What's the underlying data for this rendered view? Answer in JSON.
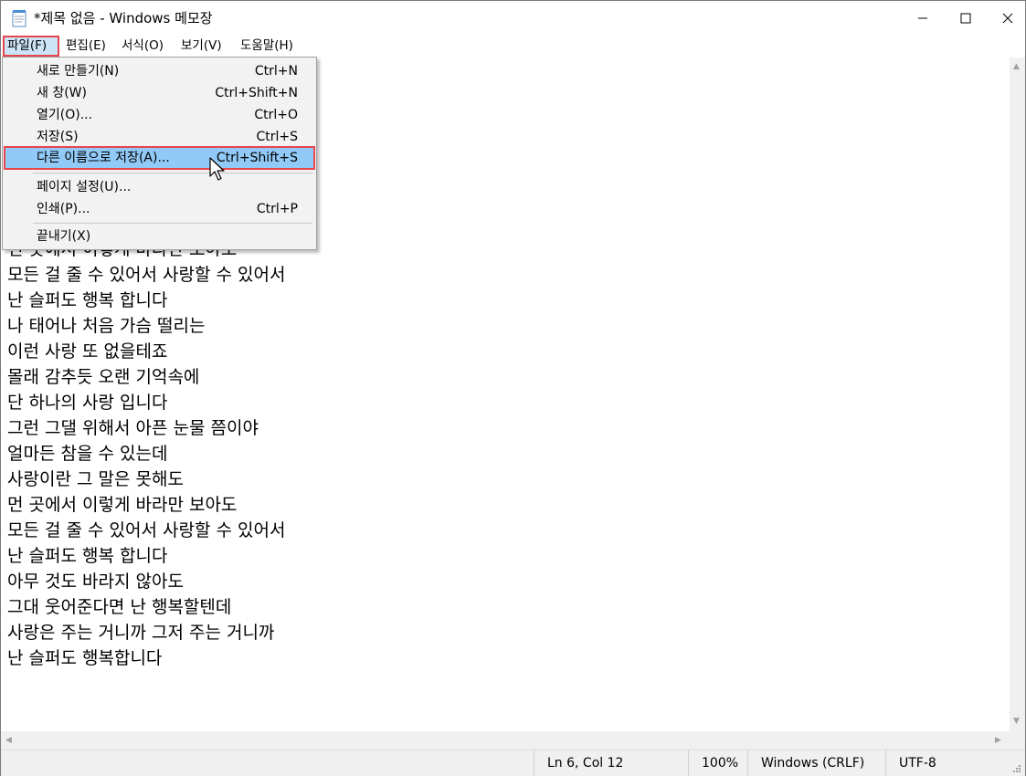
{
  "window": {
    "title": "*제목 없음 - Windows 메모장",
    "app_icon": "notepad-icon",
    "controls": [
      "minimize-icon",
      "maximize-icon",
      "close-icon"
    ]
  },
  "menubar": {
    "items": [
      {
        "label": "파일(F)",
        "active": true
      },
      {
        "label": "편집(E)"
      },
      {
        "label": "서식(O)"
      },
      {
        "label": "보기(V)"
      },
      {
        "label": "도움말(H)"
      }
    ]
  },
  "file_menu": {
    "items": [
      {
        "label": "새로 만들기(N)",
        "shortcut": "Ctrl+N"
      },
      {
        "label": "새 창(W)",
        "shortcut": "Ctrl+Shift+N"
      },
      {
        "label": "열기(O)...",
        "shortcut": "Ctrl+O"
      },
      {
        "label": "저장(S)",
        "shortcut": "Ctrl+S"
      },
      {
        "label": "다른 이름으로 저장(A)...",
        "shortcut": "Ctrl+Shift+S",
        "highlighted": true
      },
      {
        "label": "페이지 설정(U)...",
        "shortcut": ""
      },
      {
        "label": "인쇄(P)...",
        "shortcut": "Ctrl+P"
      },
      {
        "label": "끝내기(X)",
        "shortcut": ""
      }
    ]
  },
  "editor": {
    "lines": [
      "",
      "",
      "",
      "",
      "",
      "",
      "",
      "먼 곳에서 이렇게 바라만 보아도",
      "모든 걸 줄 수 있어서 사랑할 수 있어서",
      "난 슬퍼도 행복 합니다",
      "나 태어나 처음 가슴 떨리는",
      "이런 사랑 또 없을테죠",
      "몰래 감추듯 오랜 기억속에",
      "단 하나의 사랑 입니다",
      "그런 그댈 위해서 아픈 눈물 쯤이야",
      "얼마든 참을 수 있는데",
      "사랑이란 그 말은 못해도",
      "먼 곳에서 이렇게 바라만 보아도",
      "모든 걸 줄 수 있어서 사랑할 수 있어서",
      "난 슬퍼도 행복 합니다",
      "아무 것도 바라지 않아도",
      "그대 웃어준다면 난 행복할텐데",
      "사랑은 주는 거니까 그저 주는 거니까",
      "난 슬퍼도 행복합니다"
    ]
  },
  "statusbar": {
    "position": "Ln 6, Col 12",
    "zoom": "100%",
    "line_ending": "Windows (CRLF)",
    "encoding": "UTF-8"
  },
  "colors": {
    "highlight": "#91c9f7",
    "callout": "#e8454d",
    "menu_bg": "#f2f2f2"
  }
}
